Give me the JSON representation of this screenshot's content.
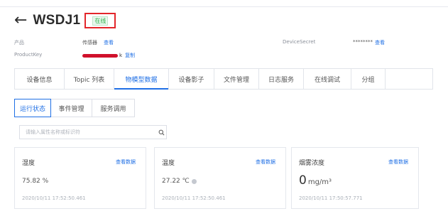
{
  "header": {
    "back_glyph": "←",
    "title": "WSDJ1",
    "status": "在线"
  },
  "meta": {
    "product_label": "产品",
    "product_value": "传感器",
    "product_link": "查看",
    "device_secret_label": "DeviceSecret",
    "device_secret_value": "********",
    "device_secret_link": "查看",
    "product_key_label": "ProductKey",
    "product_key_tail": "k",
    "product_key_link": "复制"
  },
  "tabs": [
    {
      "label": "设备信息"
    },
    {
      "label": "Topic 列表"
    },
    {
      "label": "物模型数据"
    },
    {
      "label": "设备影子"
    },
    {
      "label": "文件管理"
    },
    {
      "label": "日志服务"
    },
    {
      "label": "在线调试"
    },
    {
      "label": "分组"
    }
  ],
  "subtabs": [
    {
      "label": "运行状态"
    },
    {
      "label": "事件管理"
    },
    {
      "label": "服务调用"
    }
  ],
  "search": {
    "placeholder": "请输入属性名称或标识符",
    "icon": "search-icon"
  },
  "cards": [
    {
      "title": "湿度",
      "link": "查看数据",
      "value": "75.82 %",
      "unit": "",
      "time": "2020/10/11 17:52:50.461"
    },
    {
      "title": "温度",
      "link": "查看数据",
      "value": "27.22 ℃",
      "unit": "",
      "time": "2020/10/11 17:52:50.461"
    },
    {
      "title": "烟雾浓度",
      "link": "查看数据",
      "value": "0",
      "unit": "mg/m³",
      "time": "2020/10/11 17:50:57.771"
    }
  ],
  "colors": {
    "accent": "#1f6fe5",
    "status_green": "#2fb24b",
    "highlight_red": "#e3262b"
  }
}
